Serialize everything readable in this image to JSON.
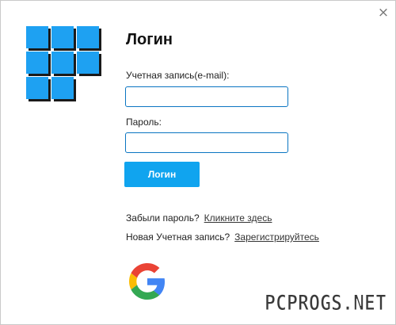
{
  "window": {
    "close_glyph": "×"
  },
  "logo": {
    "icon": "app-logo-icon",
    "color": "#1ea1f2",
    "shadow_color": "#1a1a1a"
  },
  "login": {
    "title": "Логин",
    "email_label": "Учетная запись(e-mail):",
    "email_value": "",
    "password_label": "Пароль:",
    "password_value": "",
    "submit_label": "Логин",
    "button_color": "#10a4ef"
  },
  "links": {
    "forgot_text": "Забыли пароль?",
    "forgot_link": "Кликните здесь",
    "register_text": "Новая Учетная запись?",
    "register_link": "Зарегистрируйтесь"
  },
  "social": {
    "google_icon": "google-icon"
  },
  "watermark": {
    "text": "PCPROGS.NET"
  }
}
